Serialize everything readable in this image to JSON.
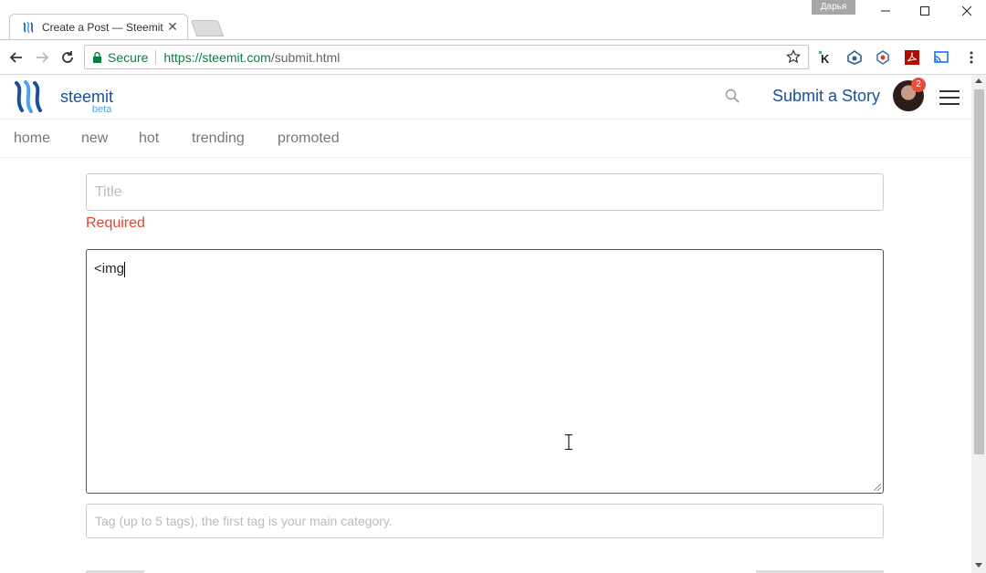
{
  "browser": {
    "tab_title": "Create a Post — Steemit",
    "tab_close": "✕",
    "profile_name": "Дарья",
    "window_controls": {
      "minimize": "—",
      "maximize": "☐",
      "close": "✕"
    },
    "secure_label": "Secure",
    "url_host": "https://steemit.com",
    "url_path": "/submit.html",
    "extensions": [
      "k-extension-icon",
      "eye-extension-icon",
      "bell-extension-icon",
      "pdf-extension-icon",
      "cast-icon",
      "menu-dots-icon"
    ]
  },
  "site": {
    "logo_text": "steemit",
    "logo_beta": "beta",
    "submit_label": "Submit a Story",
    "notification_count": "2",
    "brand_color": "#1a5099",
    "accent_color": "#4ba2f2"
  },
  "subnav": {
    "items": [
      "home",
      "new",
      "hot",
      "trending",
      "promoted"
    ]
  },
  "form": {
    "title_placeholder": "Title",
    "title_value": "",
    "required_label": "Required",
    "required_color": "#e0452e",
    "body_value": "<img",
    "tags_placeholder": "Tag (up to 5 tags), the first tag is your main category."
  }
}
